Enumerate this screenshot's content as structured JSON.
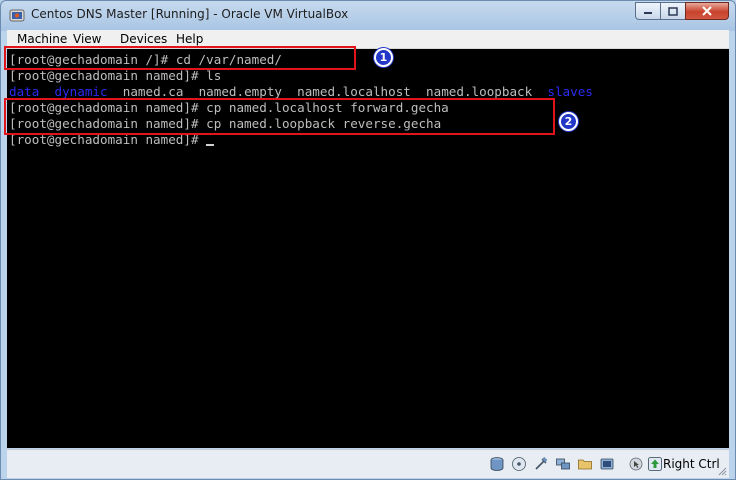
{
  "window": {
    "title": "Centos DNS Master [Running] - Oracle VM VirtualBox"
  },
  "menu": [
    "Machine",
    "View",
    "Devices",
    "Help"
  ],
  "terminal": {
    "lines": [
      {
        "prompt": "[root@gechadomain /]# ",
        "command": "cd /var/named/"
      },
      {
        "prompt": "[root@gechadomain named]# ",
        "command": "ls"
      },
      {
        "listing": {
          "dir1": "data",
          "dir2": "dynamic",
          "files": "  named.ca  named.empty  named.localhost  named.loopback  ",
          "dir3": "slaves"
        }
      },
      {
        "prompt": "[root@gechadomain named]# ",
        "command": "cp named.localhost forward.gecha"
      },
      {
        "prompt": "[root@gechadomain named]# ",
        "command": "cp named.loopback reverse.gecha"
      },
      {
        "prompt": "[root@gechadomain named]# ",
        "command": ""
      }
    ]
  },
  "annotations": {
    "marker1": "1",
    "marker2": "2",
    "color": "#e0141a"
  },
  "statusbar": {
    "host_key": "Right Ctrl"
  },
  "colors": {
    "terminal_bg": "#000000",
    "terminal_fg": "#bdbdbd",
    "dir_color": "#2a2af0"
  }
}
